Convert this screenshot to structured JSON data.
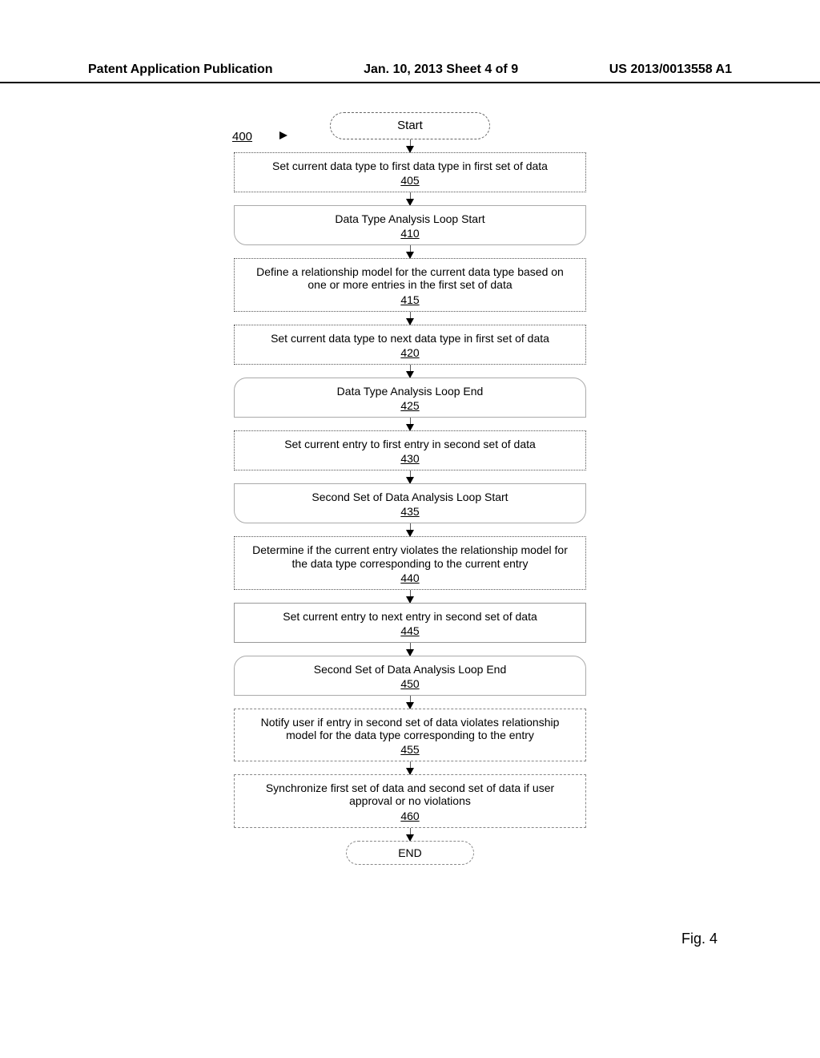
{
  "header": {
    "left": "Patent Application Publication",
    "center": "Jan. 10, 2013  Sheet 4 of 9",
    "right": "US 2013/0013558 A1"
  },
  "diagram": {
    "ref_label": "400",
    "fig_label": "Fig. 4",
    "start": "Start",
    "end": "END",
    "steps": [
      {
        "text": "Set current data type to first data type in first set of data",
        "num": "405",
        "shape": "process"
      },
      {
        "text": "Data Type Analysis Loop Start",
        "num": "410",
        "shape": "loop-start"
      },
      {
        "text": "Define a relationship model for the current data type based on one or more entries in the first set of data",
        "num": "415",
        "shape": "process"
      },
      {
        "text": "Set current data type to next data type in first set of data",
        "num": "420",
        "shape": "process"
      },
      {
        "text": "Data Type Analysis Loop End",
        "num": "425",
        "shape": "loop-end"
      },
      {
        "text": "Set current entry to first entry in second set of data",
        "num": "430",
        "shape": "process"
      },
      {
        "text": "Second Set of Data Analysis Loop Start",
        "num": "435",
        "shape": "loop-start"
      },
      {
        "text": "Determine if the current entry violates the relationship model for the data type corresponding to the current entry",
        "num": "440",
        "shape": "process"
      },
      {
        "text": "Set current entry to next entry in second set of data",
        "num": "445",
        "shape": "process-solid"
      },
      {
        "text": "Second Set of Data Analysis Loop End",
        "num": "450",
        "shape": "loop-end"
      },
      {
        "text": "Notify user if entry in second set of data violates relationship model for the data type corresponding to the entry",
        "num": "455",
        "shape": "process-dashed"
      },
      {
        "text": "Synchronize first set of data and second set of data if user approval or no violations",
        "num": "460",
        "shape": "process-dashed"
      }
    ]
  }
}
